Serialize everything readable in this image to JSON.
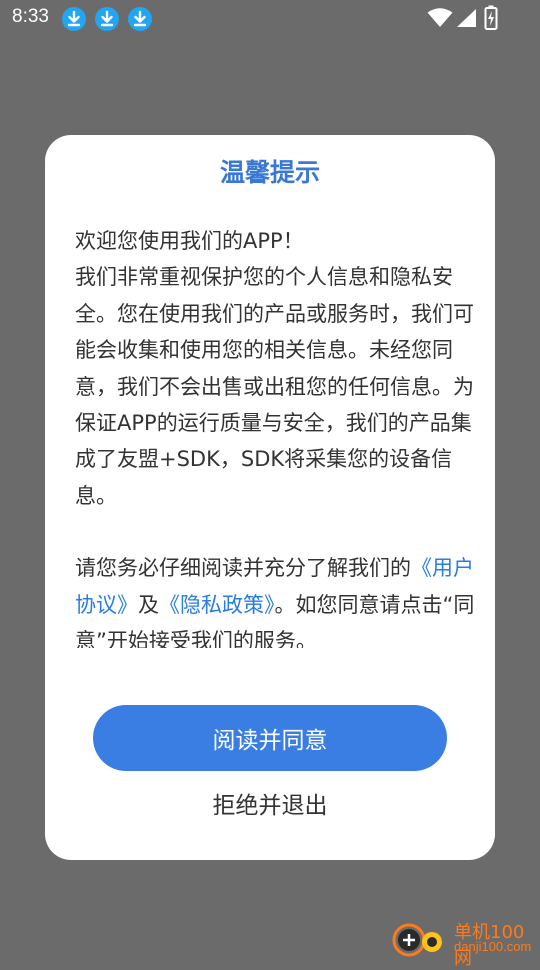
{
  "status_bar": {
    "time": "8:33",
    "icons": [
      "download-icon",
      "download-icon",
      "download-icon",
      "wifi-icon",
      "signal-icon",
      "battery-charging-icon"
    ]
  },
  "dialog": {
    "title": "温馨提示",
    "paragraph1_line1": "欢迎您使用我们的APP！",
    "paragraph1_body": "我们非常重视保护您的个人信息和隐私安全。您在使用我们的产品或服务时，我们可能会收集和使用您的相关信息。未经您同意，我们不会出售或出租您的任何信息。为保证APP的运行质量与安全，我们的产品集成了友盟+SDK，SDK将采集您的设备信息。",
    "paragraph2_prefix": "请您务必仔细阅读并充分了解我们的",
    "user_agreement_link": "《用户协议》",
    "and_text": "及",
    "privacy_policy_link": "《隐私政策》",
    "paragraph2_suffix": "。如您同意请点击“同意”开始接受我们的服务。",
    "agree_label": "阅读并同意",
    "refuse_label": "拒绝并退出"
  },
  "watermark": {
    "cn": "单机100网",
    "en": "danji100.com"
  },
  "colors": {
    "title": "#3a78d6",
    "link": "#2a7de0",
    "button": "#3a7ee4",
    "overlay": "#6b6b6b",
    "watermark": "#ff7a1a"
  }
}
